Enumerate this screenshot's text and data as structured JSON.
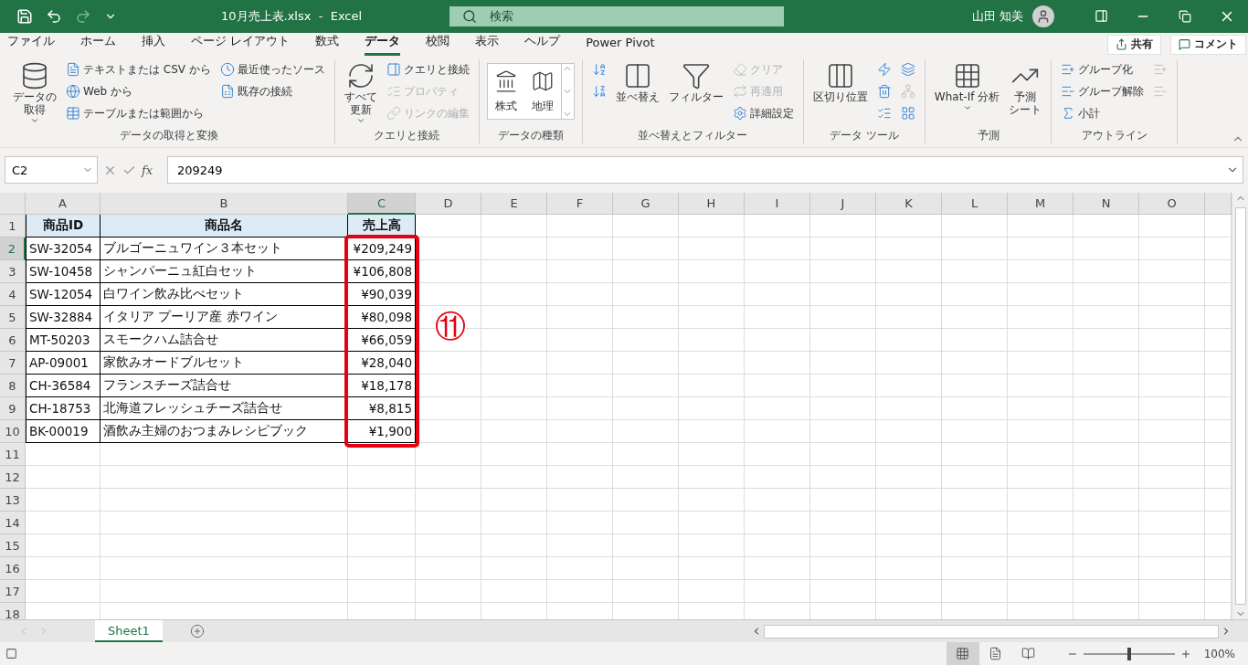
{
  "title_bar": {
    "title": "10月売上表.xlsx  -  Excel",
    "search": {
      "placeholder": "検索"
    },
    "user": "山田 知美",
    "redo_disabled": true
  },
  "menu_tabs": [
    {
      "label": "ファイル",
      "selected": false
    },
    {
      "label": "ホーム",
      "selected": false
    },
    {
      "label": "挿入",
      "selected": false
    },
    {
      "label": "ページ レイアウト",
      "selected": false
    },
    {
      "label": "数式",
      "selected": false
    },
    {
      "label": "データ",
      "selected": true
    },
    {
      "label": "校閲",
      "selected": false
    },
    {
      "label": "表示",
      "selected": false
    },
    {
      "label": "ヘルプ",
      "selected": false
    },
    {
      "label": "Power Pivot",
      "selected": false
    }
  ],
  "share_button": "共有",
  "comment_button": "コメント",
  "ribbon_groups": [
    {
      "label": "データの取得と変換",
      "columns": [
        {
          "kind": "large",
          "lines": [
            "データの",
            "取得"
          ],
          "dropdown": true
        },
        {
          "kind": "stack",
          "items": [
            {
              "label": "テキストまたは CSV から",
              "disabled": false
            },
            {
              "label": "Web から",
              "disabled": false
            },
            {
              "label": "テーブルまたは範囲から",
              "disabled": false
            }
          ]
        },
        {
          "kind": "stack",
          "items": [
            {
              "label": "最近使ったソース",
              "disabled": false
            },
            {
              "label": "既存の接続",
              "disabled": false
            }
          ]
        }
      ]
    },
    {
      "label": "クエリと接続",
      "columns": [
        {
          "kind": "large",
          "lines": [
            "すべて",
            "更新"
          ],
          "dropdown": true
        },
        {
          "kind": "stack",
          "items": [
            {
              "label": "クエリと接続",
              "disabled": false
            },
            {
              "label": "プロパティ",
              "disabled": true
            },
            {
              "label": "リンクの編集",
              "disabled": true
            }
          ]
        }
      ]
    },
    {
      "label": "データの種類",
      "columns": [
        {
          "kind": "gallery",
          "items": [
            {
              "label": "株式"
            },
            {
              "label": "地理"
            }
          ]
        }
      ]
    },
    {
      "label": "並べ替えとフィルター",
      "columns": [
        {
          "kind": "stack",
          "items": [
            {
              "disabled": false
            },
            {
              "disabled": false
            }
          ]
        },
        {
          "kind": "large",
          "lines": [
            "並べ替え"
          ],
          "dropdown": false
        },
        {
          "kind": "large",
          "lines": [
            "フィルター"
          ],
          "dropdown": false
        },
        {
          "kind": "stack",
          "items": [
            {
              "label": "クリア",
              "disabled": true
            },
            {
              "label": "再適用",
              "disabled": true
            },
            {
              "label": "詳細設定",
              "disabled": false
            }
          ]
        }
      ]
    },
    {
      "label": "データ ツール",
      "columns": [
        {
          "kind": "large",
          "lines": [
            "区切り位置"
          ],
          "dropdown": false
        },
        {
          "kind": "stack",
          "items": [
            {
              "disabled": false
            },
            {
              "disabled": false
            },
            {
              "disabled": false
            }
          ]
        },
        {
          "kind": "stack",
          "items": [
            {
              "disabled": false
            },
            {
              "disabled": true
            },
            {
              "disabled": false
            }
          ]
        }
      ]
    },
    {
      "label": "予測",
      "columns": [
        {
          "kind": "large",
          "lines": [
            "What-If 分析"
          ],
          "dropdown": true
        },
        {
          "kind": "large",
          "lines": [
            "予測",
            "シート"
          ],
          "dropdown": false
        }
      ]
    },
    {
      "label": "アウトライン",
      "columns": [
        {
          "kind": "stack",
          "items": [
            {
              "label": "グループ化",
              "disabled": false
            },
            {
              "label": "グループ解除",
              "disabled": false
            },
            {
              "label": "小計",
              "disabled": false
            }
          ]
        },
        {
          "kind": "stack",
          "items": [
            {
              "disabled": true
            },
            {
              "disabled": true
            }
          ]
        }
      ]
    }
  ],
  "formula_bar": {
    "name_box": "C2",
    "function_label": "fx",
    "value": "209249"
  },
  "sheet": {
    "columns": [
      {
        "label": "A",
        "selected": false
      },
      {
        "label": "B",
        "selected": false
      },
      {
        "label": "C",
        "selected": true
      },
      {
        "label": "D",
        "selected": false
      },
      {
        "label": "E",
        "selected": false
      },
      {
        "label": "F",
        "selected": false
      },
      {
        "label": "G",
        "selected": false
      },
      {
        "label": "H",
        "selected": false
      },
      {
        "label": "I",
        "selected": false
      },
      {
        "label": "J",
        "selected": false
      },
      {
        "label": "K",
        "selected": false
      },
      {
        "label": "L",
        "selected": false
      },
      {
        "label": "M",
        "selected": false
      },
      {
        "label": "N",
        "selected": false
      },
      {
        "label": "O",
        "selected": false
      }
    ],
    "rows": [
      {
        "header": "1",
        "selected": false,
        "kind": "header",
        "cells": [
          "商品ID",
          "商品名",
          "売上高"
        ]
      },
      {
        "header": "2",
        "selected": true,
        "kind": "data",
        "cells": [
          "SW-32054",
          "ブルゴーニュワイン３本セット",
          "¥209,249"
        ]
      },
      {
        "header": "3",
        "selected": false,
        "kind": "data",
        "cells": [
          "SW-10458",
          "シャンパーニュ紅白セット",
          "¥106,808"
        ]
      },
      {
        "header": "4",
        "selected": false,
        "kind": "data",
        "cells": [
          "SW-12054",
          "白ワイン飲み比べセット",
          "¥90,039"
        ]
      },
      {
        "header": "5",
        "selected": false,
        "kind": "data",
        "cells": [
          "SW-32884",
          "イタリア プーリア産 赤ワイン",
          "¥80,098"
        ]
      },
      {
        "header": "6",
        "selected": false,
        "kind": "data",
        "cells": [
          "MT-50203",
          "スモークハム詰合せ",
          "¥66,059"
        ]
      },
      {
        "header": "7",
        "selected": false,
        "kind": "data",
        "cells": [
          "AP-09001",
          "家飲みオードブルセット",
          "¥28,040"
        ]
      },
      {
        "header": "8",
        "selected": false,
        "kind": "data",
        "cells": [
          "CH-36584",
          "フランスチーズ詰合せ",
          "¥18,178"
        ]
      },
      {
        "header": "9",
        "selected": false,
        "kind": "data",
        "cells": [
          "CH-18753",
          "北海道フレッシュチーズ詰合せ",
          "¥8,815"
        ]
      },
      {
        "header": "10",
        "selected": false,
        "kind": "data",
        "cells": [
          "BK-00019",
          "酒飲み主婦のおつまみレシピブック",
          "¥1,900"
        ]
      },
      {
        "header": "11",
        "selected": false
      },
      {
        "header": "12",
        "selected": false
      },
      {
        "header": "13",
        "selected": false
      },
      {
        "header": "14",
        "selected": false
      },
      {
        "header": "15",
        "selected": false
      },
      {
        "header": "16",
        "selected": false
      },
      {
        "header": "17",
        "selected": false
      },
      {
        "header": "18",
        "selected": false
      }
    ]
  },
  "annotation": {
    "marker": "⑪"
  },
  "sheet_tabs": [
    {
      "label": "Sheet1",
      "selected": true
    }
  ],
  "status_bar": {
    "views": [
      {
        "selected": true
      },
      {
        "selected": false
      },
      {
        "selected": false
      }
    ],
    "zoom": {
      "level": 0.5,
      "reading": "100%"
    }
  }
}
